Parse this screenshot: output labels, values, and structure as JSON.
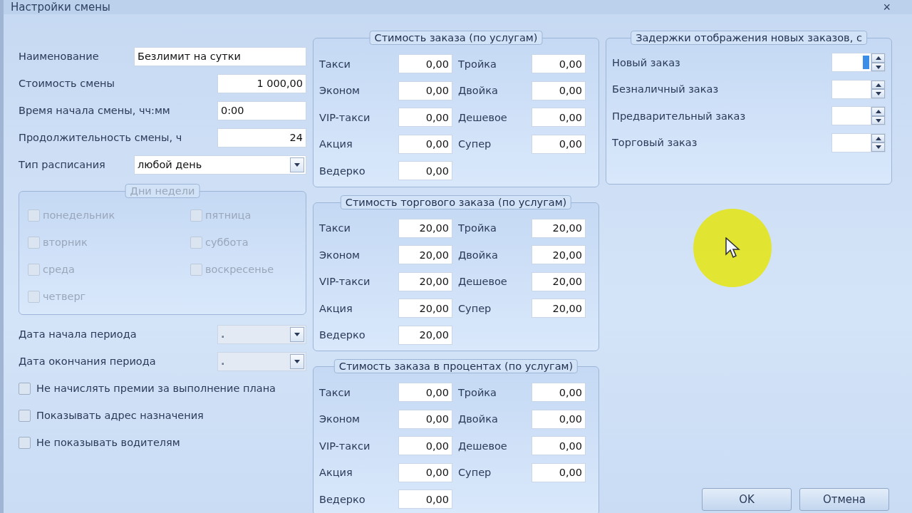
{
  "window": {
    "title": "Настройки смены",
    "close": "×"
  },
  "fields": [
    {
      "kind": "text",
      "label": "Наименование",
      "value": "Безлимит на сутки"
    },
    {
      "kind": "number",
      "label": "Стоимость смены",
      "value": "1 000,00"
    },
    {
      "kind": "time",
      "label": "Время начала смены, чч:мм",
      "value": "0:00"
    },
    {
      "kind": "number",
      "label": "Продолжительность смены, ч",
      "value": "24"
    },
    {
      "kind": "select",
      "label": "Тип расписания",
      "value": "любой день"
    }
  ],
  "weekdays": {
    "title": "Дни недели",
    "disabled": true,
    "items": [
      {
        "label": "понедельник",
        "checked": false
      },
      {
        "label": "пятница",
        "checked": false
      },
      {
        "label": "вторник",
        "checked": false
      },
      {
        "label": "суббота",
        "checked": false
      },
      {
        "label": "среда",
        "checked": false
      },
      {
        "label": "воскресенье",
        "checked": false
      },
      {
        "label": "четверг",
        "checked": false
      }
    ]
  },
  "period": [
    {
      "label": "Дата начала периода",
      "value": ".",
      "disabled": true
    },
    {
      "label": "Дата окончания периода",
      "value": ".",
      "disabled": true
    }
  ],
  "options": [
    {
      "label": "Не начислять премии за выполнение плана",
      "checked": false
    },
    {
      "label": "Показывать адрес назначения",
      "checked": false
    },
    {
      "label": "Не показывать водителям",
      "checked": false
    }
  ],
  "price_groups": [
    {
      "title": "Стимость заказа (по услугам)",
      "items": [
        {
          "label": "Такси",
          "value": "0,00"
        },
        {
          "label": "Тройка",
          "value": "0,00"
        },
        {
          "label": "Эконом",
          "value": "0,00"
        },
        {
          "label": "Двойка",
          "value": "0,00"
        },
        {
          "label": "VIP-такси",
          "value": "0,00"
        },
        {
          "label": "Дешевое",
          "value": "0,00"
        },
        {
          "label": "Акция",
          "value": "0,00"
        },
        {
          "label": "Супер",
          "value": "0,00"
        },
        {
          "label": "Ведерко",
          "value": "0,00"
        }
      ]
    },
    {
      "title": "Стимость торгового заказа (по услугам)",
      "items": [
        {
          "label": "Такси",
          "value": "20,00"
        },
        {
          "label": "Тройка",
          "value": "20,00"
        },
        {
          "label": "Эконом",
          "value": "20,00"
        },
        {
          "label": "Двойка",
          "value": "20,00"
        },
        {
          "label": "VIP-такси",
          "value": "20,00"
        },
        {
          "label": "Дешевое",
          "value": "20,00"
        },
        {
          "label": "Акция",
          "value": "20,00"
        },
        {
          "label": "Супер",
          "value": "20,00"
        },
        {
          "label": "Ведерко",
          "value": "20,00"
        }
      ]
    },
    {
      "title": "Стимость заказа в процентах (по услугам)",
      "items": [
        {
          "label": "Такси",
          "value": "0,00"
        },
        {
          "label": "Тройка",
          "value": "0,00"
        },
        {
          "label": "Эконом",
          "value": "0,00"
        },
        {
          "label": "Двойка",
          "value": "0,00"
        },
        {
          "label": "VIP-такси",
          "value": "0,00"
        },
        {
          "label": "Дешевое",
          "value": "0,00"
        },
        {
          "label": "Акция",
          "value": "0,00"
        },
        {
          "label": "Супер",
          "value": "0,00"
        },
        {
          "label": "Ведерко",
          "value": "0,00"
        }
      ]
    }
  ],
  "delays": {
    "title": "Задержки отображения новых заказов, с",
    "items": [
      {
        "label": "Новый заказ",
        "focused": true
      },
      {
        "label": "Безналичный заказ",
        "focused": false
      },
      {
        "label": "Предварительный заказ",
        "focused": false
      },
      {
        "label": "Торговый заказ",
        "focused": false
      }
    ]
  },
  "buttons": [
    {
      "label": "OK"
    },
    {
      "label": "Отмена"
    }
  ]
}
